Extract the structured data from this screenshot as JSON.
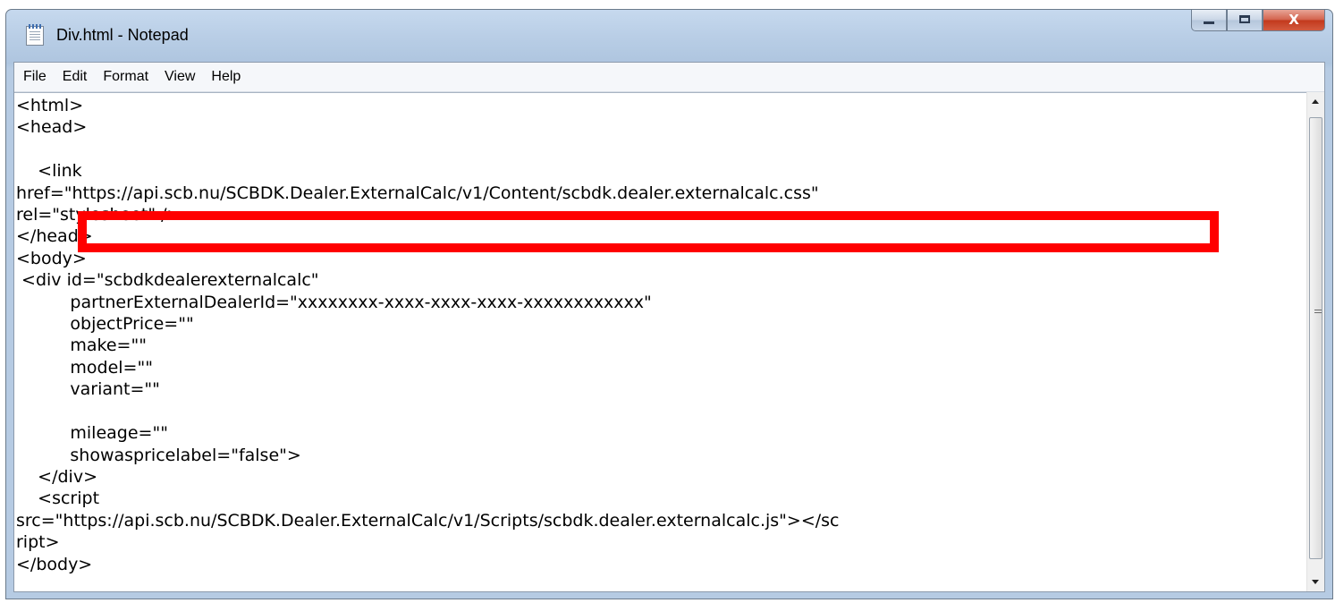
{
  "window": {
    "title": "Div.html - Notepad",
    "close_glyph": "X"
  },
  "menu": [
    "File",
    "Edit",
    "Format",
    "View",
    "Help"
  ],
  "editor": {
    "lines": [
      "<html>",
      "<head>",
      "",
      "    <link",
      "href=\"https://api.scb.nu/SCBDK.Dealer.ExternalCalc/v1/Content/scbdk.dealer.externalcalc.css\"",
      "rel=\"stylesheet\" />",
      "</head>",
      "<body>",
      " <div id=\"scbdkdealerexternalcalc\"",
      "          partnerExternalDealerId=\"xxxxxxxx-xxxx-xxxx-xxxx-xxxxxxxxxxxx\"",
      "          objectPrice=\"\"",
      "          make=\"\"",
      "          model=\"\"",
      "          variant=\"\"",
      "",
      "          mileage=\"\"",
      "          showaspricelabel=\"false\">",
      "    </div>",
      "    <script",
      "src=\"https://api.scb.nu/SCBDK.Dealer.ExternalCalc/v1/Scripts/scbdk.dealer.externalcalc.js\"></sc",
      "ript>",
      "</body>"
    ]
  },
  "annotation": {
    "color": "#ff0000"
  }
}
